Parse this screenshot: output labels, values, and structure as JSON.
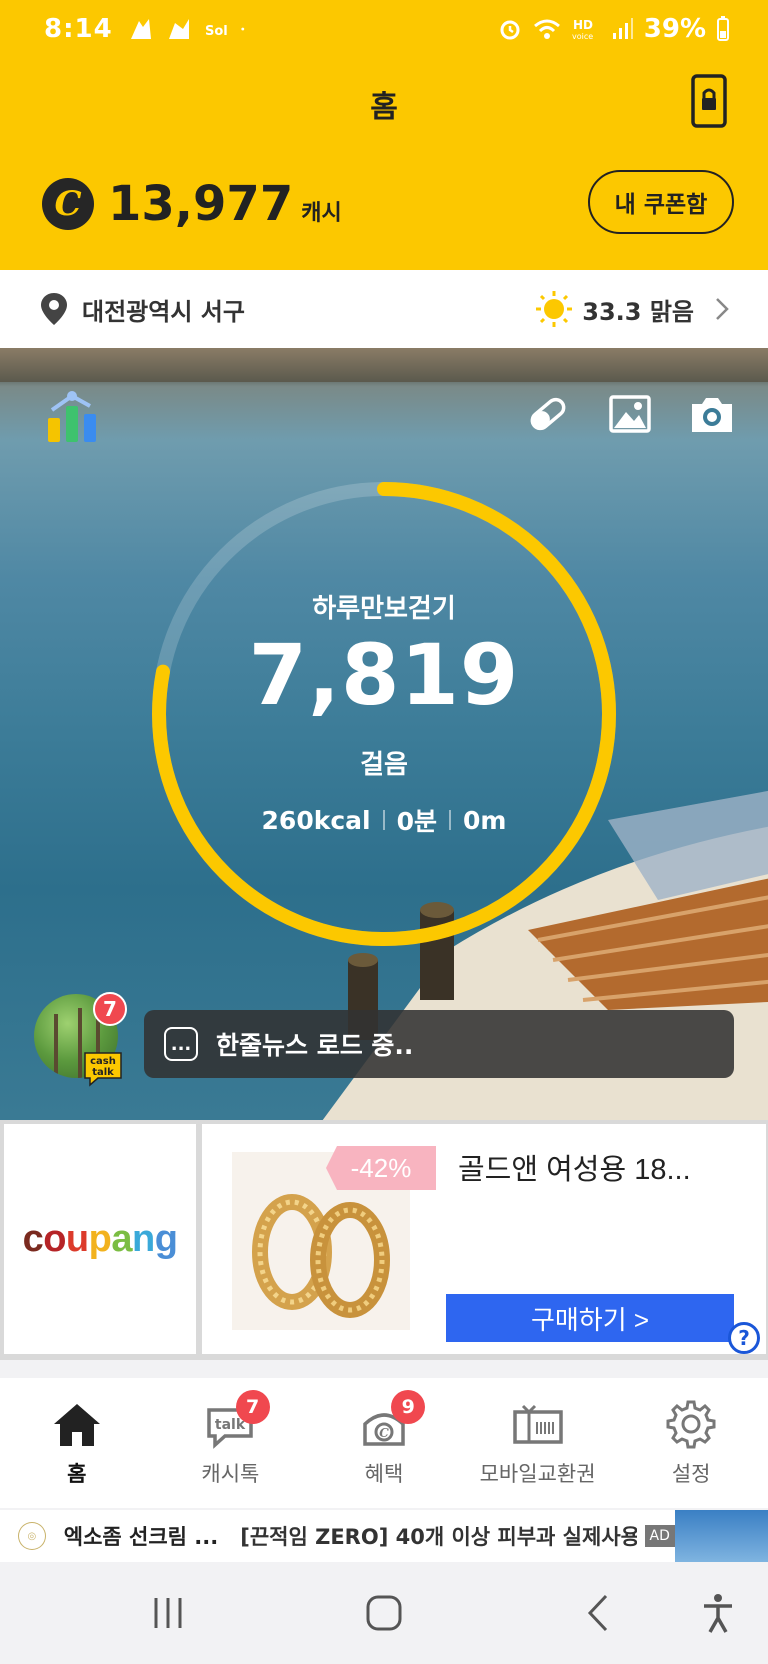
{
  "status_bar": {
    "time": "8:14",
    "battery": "39%"
  },
  "header": {
    "title": "홈",
    "cash_amount": "13,977",
    "cash_unit": "캐시",
    "coupon_button": "내 쿠폰함"
  },
  "location": {
    "place": "대전광역시 서구",
    "weather": "33.3 맑음"
  },
  "walk": {
    "title": "하루만보걷기",
    "steps": "7,819",
    "unit": "걸음",
    "progress": 0.78,
    "kcal": "260kcal",
    "minutes": "0분",
    "distance": "0m"
  },
  "cashtalk": {
    "badge": "7",
    "tag_line1": "cash",
    "tag_line2": "talk",
    "news_icon": "...",
    "news_text": "한줄뉴스 로드 중.."
  },
  "ad": {
    "brand": "coupang",
    "discount": "-42%",
    "title": "골드앤 여성용 18...",
    "buy_button": "구매하기 >",
    "help": "?"
  },
  "bottom_nav": [
    {
      "label": "홈",
      "icon": "home-icon",
      "badge": ""
    },
    {
      "label": "캐시톡",
      "icon": "talk-icon",
      "badge": "7"
    },
    {
      "label": "혜택",
      "icon": "benefit-icon",
      "badge": "9"
    },
    {
      "label": "모바일교환권",
      "icon": "voucher-icon",
      "badge": ""
    },
    {
      "label": "설정",
      "icon": "settings-icon",
      "badge": ""
    }
  ],
  "ad_strip": {
    "brand": "엑소좀 선크림 ...",
    "text": "[끈적임 ZERO] 40개 이상 피부과 실제사용...",
    "label": "AD"
  },
  "colors": {
    "primary": "#fcc800",
    "badge": "#f0484f",
    "buy": "#2e66f0"
  }
}
